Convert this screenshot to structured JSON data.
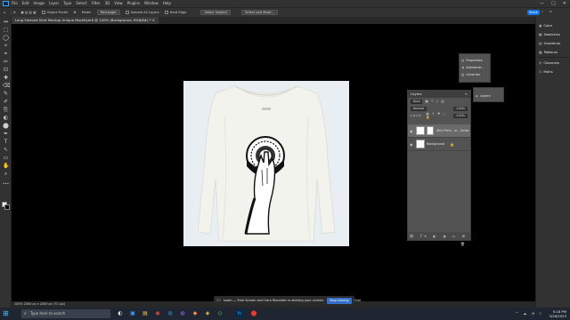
{
  "menu": {
    "app_logo": "Ps",
    "items": [
      "File",
      "Edit",
      "Image",
      "Layer",
      "Type",
      "Select",
      "Filter",
      "3D",
      "View",
      "Plugins",
      "Window",
      "Help"
    ],
    "window_controls": [
      "—",
      "□",
      "✕"
    ]
  },
  "options": {
    "auto_select": "Object Finder",
    "mode_label": "Mode:",
    "mode_value": "Rectangle",
    "sample_all_layers": "Sample All Layers",
    "hard_edge": "Hard Edge",
    "select_subject": "Select Subject",
    "select_and_mask": "Select and Mask...",
    "share": "Share"
  },
  "document": {
    "tab_title": "Long Sleeved Shirt Mockup Unique Mockflyer6 @ 100% (Background, RGB/8#) *"
  },
  "toolbar": {
    "tools": [
      "↔",
      "⬚",
      "◯",
      "✧",
      "⌖",
      "✂",
      "⊡",
      "✚",
      "⌫",
      "✎",
      "✐",
      "⎘",
      "◐",
      "⬤",
      "✒",
      "T",
      "↖",
      "▭",
      "✋",
      "⌕",
      "•••"
    ]
  },
  "floating_panel_1": {
    "items": [
      {
        "icon": "▤",
        "label": "Properties"
      },
      {
        "icon": "◑",
        "label": "Adjustme..."
      },
      {
        "icon": "▥",
        "label": "Libraries"
      }
    ]
  },
  "floating_panel_2": {
    "items": [
      {
        "icon": "◈",
        "label": "Layers"
      }
    ]
  },
  "layers": {
    "title": "Layers",
    "filter_kind": "Kind",
    "blend_mode": "Normal",
    "opacity": "100%",
    "lock_label": "Lock:",
    "fill": "100%",
    "items": [
      {
        "name": "Shirt Print - or - Smile",
        "visible": true
      },
      {
        "name": "Background",
        "visible": true
      }
    ],
    "footer_icons": "⛓ fx ◐ ◑ ▭ ⊞ 🗑"
  },
  "dock": {
    "items": [
      {
        "icon": "◕",
        "label": "Color"
      },
      {
        "icon": "▦",
        "label": "Swatches"
      },
      {
        "icon": "▤",
        "label": "Gradients"
      },
      {
        "icon": "▩",
        "label": "Patterns"
      },
      {
        "icon": "◎",
        "label": "Channels"
      },
      {
        "icon": "⬠",
        "label": "Paths"
      }
    ]
  },
  "status": {
    "text": "100%   2000 px x 2000 px (72 ppi)"
  },
  "loom": {
    "text": "Loom — Free Screen and Cam Recorder is sharing your screen.",
    "stop_button": "Stop sharing",
    "hide_button": "Hide"
  },
  "taskbar": {
    "search_placeholder": "Type here to search",
    "apps": [
      "◐",
      "▣",
      "▤",
      "◉",
      "◎",
      "◍",
      "◆",
      "◈",
      "◇",
      "Ps",
      "⬤"
    ],
    "time": "5:18 PM",
    "date": "3/26/2023"
  }
}
